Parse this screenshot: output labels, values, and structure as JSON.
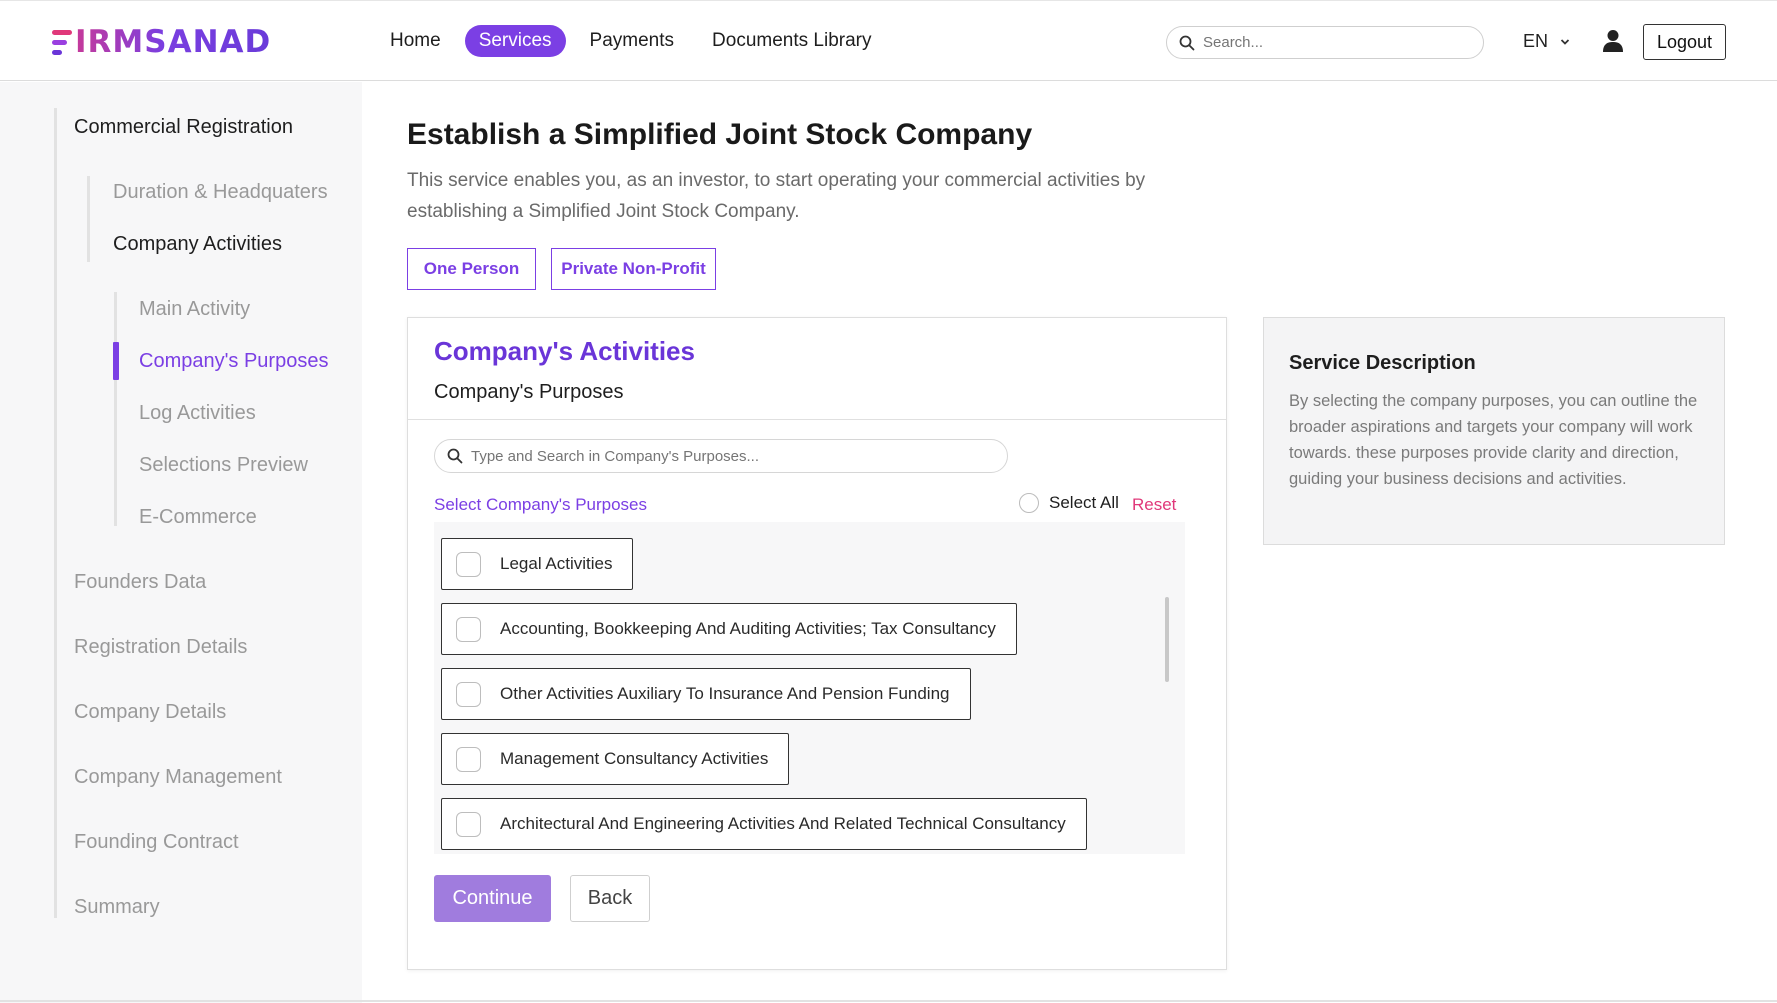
{
  "header": {
    "logo_text": "IRMSANAD",
    "nav": [
      "Home",
      "Services",
      "Payments",
      "Documents Library"
    ],
    "active_nav": "Services",
    "search_placeholder": "Search...",
    "language": "EN",
    "logout_label": "Logout"
  },
  "sidebar": {
    "commercial_registration": "Commercial Registration",
    "duration_headquarters": "Duration & Headquaters",
    "company_activities": "Company Activities",
    "main_activity": "Main Activity",
    "company_purposes": "Company's Purposes",
    "log_activities": "Log Activities",
    "selections_preview": "Selections Preview",
    "e_commerce": "E-Commerce",
    "founders_data": "Founders Data",
    "registration_details": "Registration Details",
    "company_details": "Company Details",
    "company_management": "Company Management",
    "founding_contract": "Founding Contract",
    "summary": "Summary"
  },
  "main": {
    "title": "Establish a Simplified Joint Stock Company",
    "description": "This service enables you, as an investor, to start operating your commercial activities by establishing a Simplified Joint Stock Company.",
    "tags": [
      "One Person",
      "Private Non-Profit"
    ]
  },
  "card": {
    "title": "Company's Activities",
    "subtitle": "Company's Purposes",
    "search_placeholder": "Type and Search in Company's Purposes...",
    "select_label": "Select Company's Purposes",
    "select_all": "Select All",
    "reset": "Reset",
    "options": [
      "Legal Activities",
      "Accounting, Bookkeeping And Auditing Activities; Tax Consultancy",
      "Other Activities Auxiliary To Insurance And Pension Funding",
      "Management Consultancy Activities",
      "Architectural And Engineering Activities And Related Technical Consultancy"
    ],
    "continue_label": "Continue",
    "back_label": "Back"
  },
  "service_description": {
    "title": "Service Description",
    "text": "By selecting the company purposes, you can outline the broader aspirations and targets your company will work towards. these purposes provide clarity and direction, guiding your business decisions and activities."
  },
  "colors": {
    "accent": "#7b3fe4",
    "reset": "#e0387a",
    "continue_bg": "#a07cde"
  }
}
